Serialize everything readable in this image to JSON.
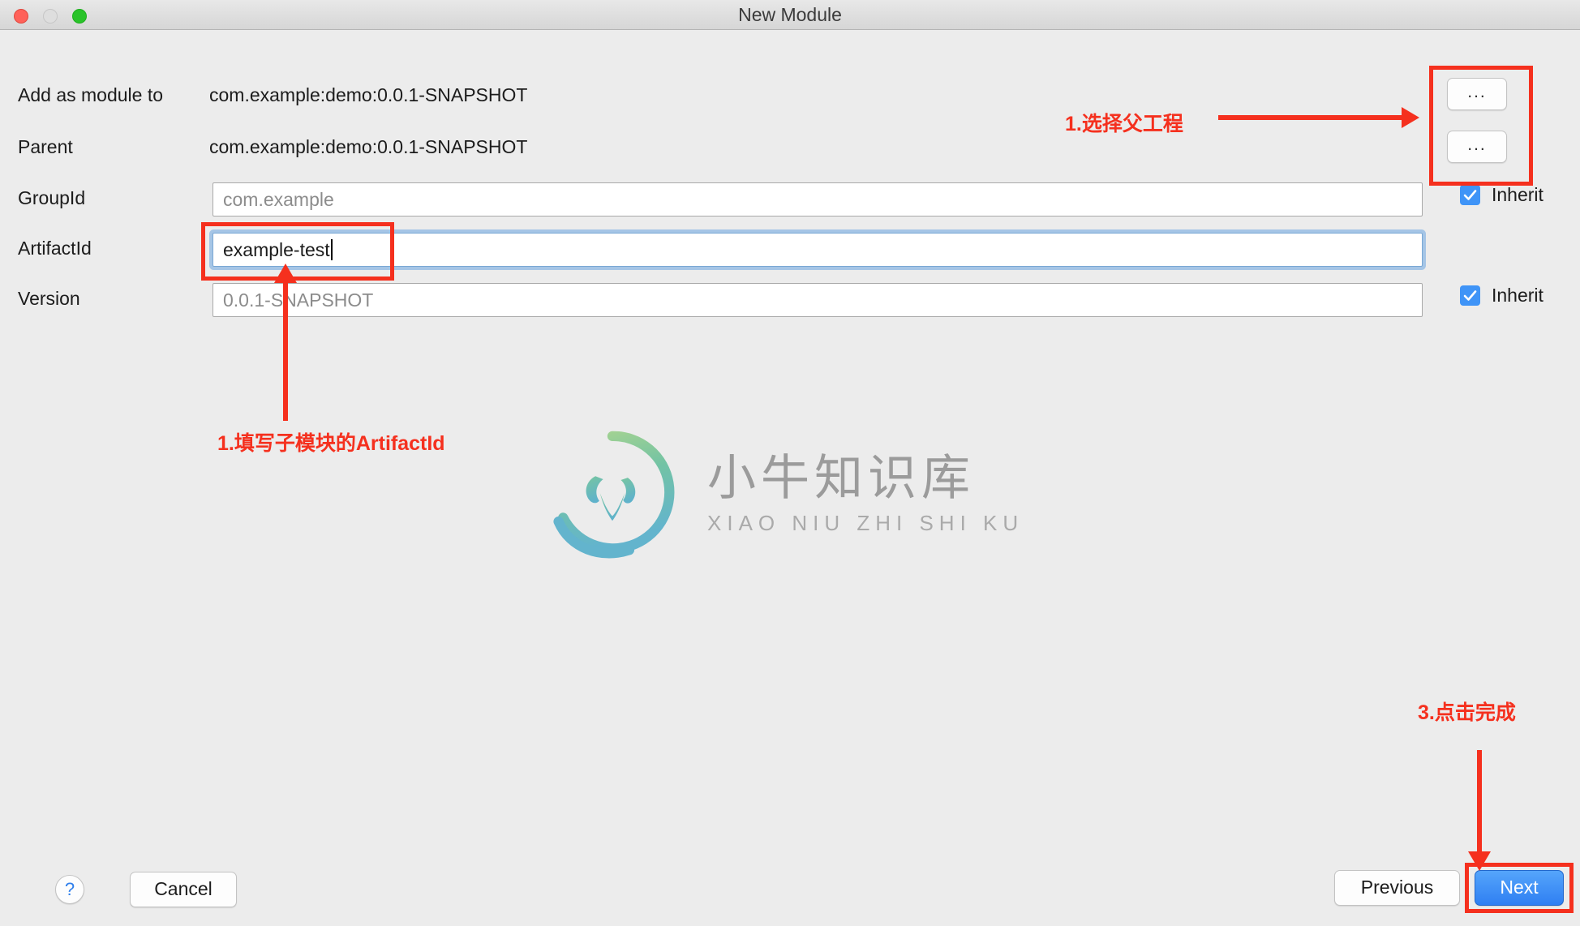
{
  "window": {
    "title": "New Module",
    "traffic_lights": {
      "close": "close-button",
      "minimize": "minimize-button",
      "maximize": "maximize-button"
    }
  },
  "form": {
    "rows": [
      {
        "label": "Add as module to",
        "value": "com.example:demo:0.0.1-SNAPSHOT",
        "type": "static"
      },
      {
        "label": "Parent",
        "value": "com.example:demo:0.0.1-SNAPSHOT",
        "type": "static"
      },
      {
        "label": "GroupId",
        "value": "",
        "placeholder": "com.example",
        "type": "input",
        "inherit_label": "Inherit",
        "inherit_checked": true
      },
      {
        "label": "ArtifactId",
        "value": "example-test",
        "placeholder": "",
        "type": "input",
        "focused": true
      },
      {
        "label": "Version",
        "value": "",
        "placeholder": "0.0.1-SNAPSHOT",
        "type": "input",
        "inherit_label": "Inherit",
        "inherit_checked": true
      }
    ],
    "browse_buttons": [
      {
        "label": "..."
      },
      {
        "label": "..."
      }
    ]
  },
  "footer": {
    "help_label": "?",
    "cancel_label": "Cancel",
    "previous_label": "Previous",
    "next_label": "Next"
  },
  "annotations": {
    "step1_parent": "1.选择父工程",
    "step1_artifact": "1.填写子模块的ArtifactId",
    "step3_finish": "3.点击完成",
    "accent_color": "#f5301e"
  },
  "watermark": {
    "cn": "小牛知识库",
    "en": "XIAO NIU ZHI SHI KU",
    "logo_colors": [
      "#9ccf87",
      "#6cc4a6",
      "#62b8cf"
    ]
  }
}
